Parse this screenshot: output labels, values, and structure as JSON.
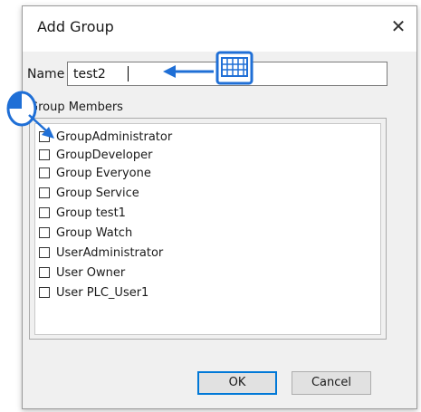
{
  "dialog": {
    "title": "Add Group",
    "close_glyph": "✕",
    "name_label": "Name",
    "name_value": "test2",
    "group_members_label": "Group Members",
    "members": [
      {
        "label": "GroupAdministrator",
        "checked": false
      },
      {
        "label": "GroupDeveloper",
        "checked": false
      },
      {
        "label": "Group Everyone",
        "checked": false
      },
      {
        "label": "Group Service",
        "checked": false
      },
      {
        "label": "Group test1",
        "checked": false
      },
      {
        "label": "Group Watch",
        "checked": false
      },
      {
        "label": "UserAdministrator",
        "checked": false
      },
      {
        "label": "User Owner",
        "checked": false
      },
      {
        "label": "User PLC_User1",
        "checked": false
      }
    ],
    "ok_label": "OK",
    "cancel_label": "Cancel"
  },
  "annotations": {
    "keyboard_icon": "keyboard-icon",
    "mouse_icon": "mouse-icon",
    "accent_color": "#1f6fd6"
  }
}
